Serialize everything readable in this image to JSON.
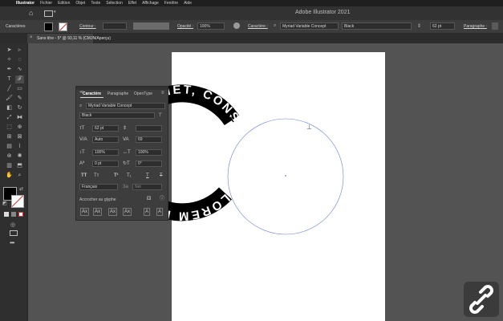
{
  "menubar": {
    "app": "Illustrator",
    "items": [
      "Fichier",
      "Edition",
      "Objet",
      "Texte",
      "Sélection",
      "Effet",
      "Affichage",
      "Fenêtre",
      "Aide"
    ]
  },
  "titlebar": {
    "title": "Adobe Illustrator 2021"
  },
  "controlbar": {
    "characters_label": "Caractères",
    "contour_label": "Contour :",
    "opacity_label": "Opacité :",
    "opacity_value": "100%",
    "character_link": "Caractère :",
    "font_family": "Myriad Variable Concept",
    "font_style": "Black",
    "font_size": "62 pt",
    "paragraph_link": "Paragraphe :"
  },
  "doc_tab": {
    "label": "Sans titre - 5* @ 93,11 % (CMJN/Aperçu)"
  },
  "artwork": {
    "path_text": "LOREM IPSUM DOLOR SIT AMET, CONSECTETUER",
    "ring_color": "#000000",
    "text_color": "#ffffff"
  },
  "character_panel": {
    "tabs": [
      "Caractère",
      "Paragraphe",
      "OpenType"
    ],
    "font_family": "Myriad Variable Concept",
    "font_style": "Black",
    "size": "62 pt",
    "leading": "",
    "kerning": "Auto",
    "tracking": "69",
    "vscale": "100%",
    "hscale": "100%",
    "baseline": "0 pt",
    "rotation": "0°",
    "language": "Français",
    "aa_label": "3a",
    "aa_value": "Net",
    "snap_label": "Accrocher au glyphe"
  },
  "colors": {
    "accent": "#4a90e2",
    "fill": "#000000",
    "stroke_none": "#e03030"
  }
}
